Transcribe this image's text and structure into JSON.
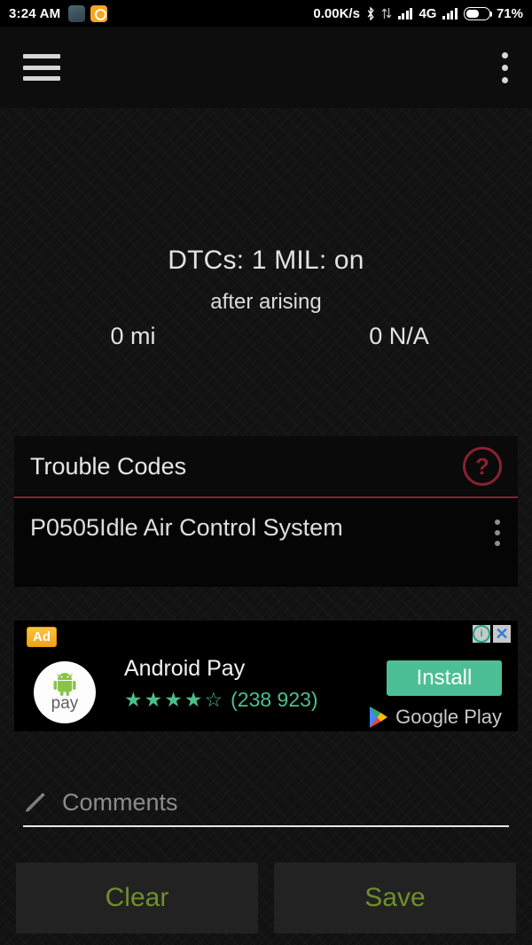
{
  "statusbar": {
    "time": "3:24 AM",
    "network_speed": "0.00K/s",
    "network_type": "4G",
    "battery_percent": "71%",
    "icons": [
      "weather-app-icon",
      "notification-app-icon",
      "bluetooth-icon",
      "data-transfer-icon",
      "signal-icon",
      "signal-icon-2",
      "battery-icon"
    ]
  },
  "appbar": {
    "menu_icon": "hamburger-menu-icon",
    "overflow_icon": "overflow-menu-icon"
  },
  "dtc": {
    "title": "DTCs: 1 MIL: on",
    "subtitle": "after arising",
    "distance": "0 mi",
    "time_value": "0 N/A"
  },
  "codes": {
    "header": "Trouble Codes",
    "help_icon": "help-question-icon",
    "accent": "#8b2030",
    "rows": [
      {
        "code": "P0505",
        "description": "Idle Air Control System"
      }
    ]
  },
  "ad": {
    "badge": "Ad",
    "app_name": "Android Pay",
    "logo_text": "pay",
    "rating_filled": 4,
    "rating_total": 5,
    "rating_count": "(238 923)",
    "install_label": "Install",
    "store_label": "Google Play",
    "info_glyph": "i",
    "close_glyph": "✕",
    "install_color": "#4cbf96",
    "badge_color": "#f1a31c"
  },
  "comments": {
    "icon": "pencil-icon",
    "placeholder": "Comments",
    "value": ""
  },
  "actions": {
    "clear_label": "Clear",
    "save_label": "Save",
    "text_color": "#6f8f2c"
  }
}
